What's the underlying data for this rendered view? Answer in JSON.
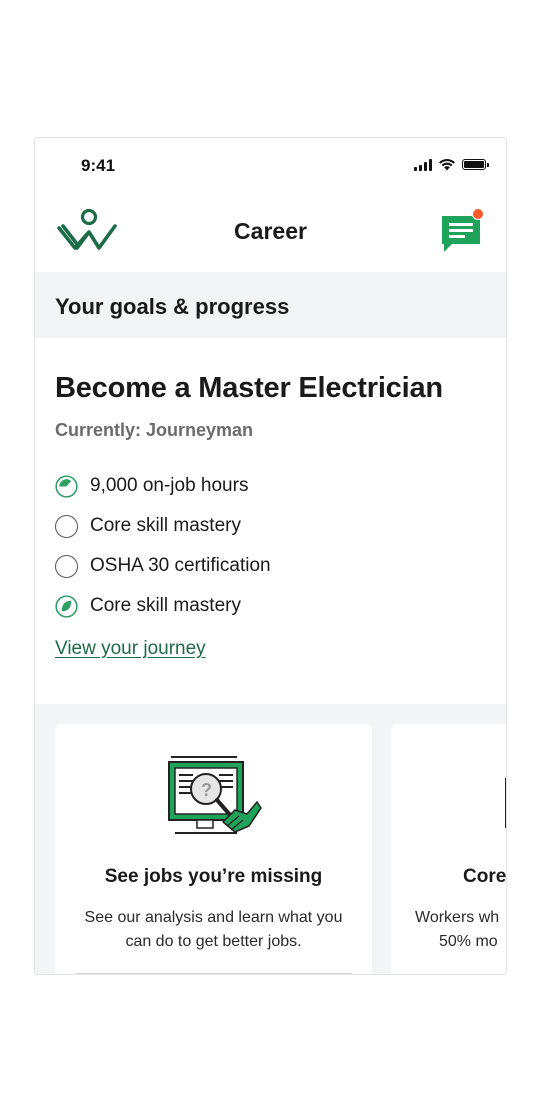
{
  "status_bar": {
    "time": "9:41"
  },
  "header": {
    "title": "Career"
  },
  "section": {
    "title": "Your goals & progress"
  },
  "goal": {
    "title": "Become a Master Electrician",
    "current": "Currently: Journeyman",
    "milestones": [
      {
        "label": "9,000 on-job hours",
        "progress": 0.4,
        "status": "in-progress"
      },
      {
        "label": "Core skill mastery",
        "progress": 0,
        "status": "not-started"
      },
      {
        "label": "OSHA 30 certification",
        "progress": 0,
        "status": "not-started"
      },
      {
        "label": "Core skill mastery",
        "progress": 0.5,
        "status": "in-progress"
      }
    ],
    "link": "View your journey"
  },
  "cards": [
    {
      "title": "See jobs you’re missing",
      "description": "See our analysis and learn what you can do to get better jobs.",
      "icon": "job-search-monitor-icon"
    },
    {
      "title": "Core",
      "description_lines": [
        "Workers wh",
        "50% mo"
      ],
      "icon": "partial-illustration"
    }
  ],
  "colors": {
    "brand_green": "#1d6b47",
    "accent_green": "#2e9e62",
    "chat_green": "#1fa35a",
    "notification": "#ff5a2c",
    "section_bg": "#f3f4f5"
  }
}
